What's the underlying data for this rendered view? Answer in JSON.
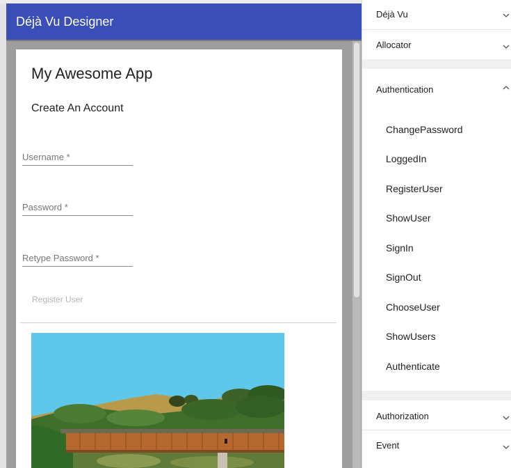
{
  "designer": {
    "title": "Déjà Vu Designer"
  },
  "page": {
    "app_title": "My Awesome App",
    "section_title": "Create An Account",
    "fields": [
      {
        "label": "Username *"
      },
      {
        "label": "Password *"
      },
      {
        "label": "Retype Password *"
      }
    ],
    "register_button": "Register User"
  },
  "sidebar": {
    "groups": [
      {
        "title": "Déjà Vu",
        "expanded": false,
        "icon": "chevron-down-icon"
      },
      {
        "title": "Allocator",
        "expanded": false,
        "icon": "chevron-down-icon"
      },
      {
        "title": "Authentication",
        "expanded": true,
        "icon": "chevron-up-icon",
        "items": [
          {
            "label": "ChangePassword"
          },
          {
            "label": "LoggedIn"
          },
          {
            "label": "RegisterUser"
          },
          {
            "label": "ShowUser"
          },
          {
            "label": "SignIn"
          },
          {
            "label": "SignOut"
          },
          {
            "label": "ChooseUser"
          },
          {
            "label": "ShowUsers"
          },
          {
            "label": "Authenticate"
          }
        ]
      },
      {
        "title": "Authorization",
        "expanded": false,
        "icon": "chevron-down-icon"
      },
      {
        "title": "Event",
        "expanded": false,
        "icon": "chevron-down-icon"
      }
    ]
  },
  "colors": {
    "header": "#3b4db6",
    "canvas": "#9e9e9e",
    "sky": "#5fc8ea",
    "bridge": "#b5692e"
  }
}
